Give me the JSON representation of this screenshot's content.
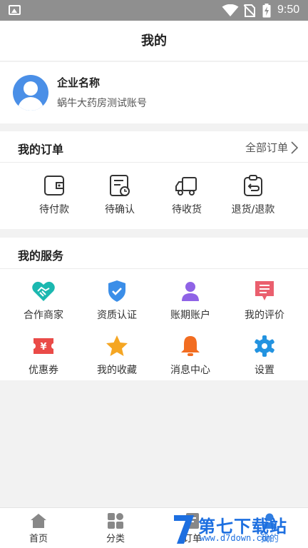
{
  "status_bar": {
    "time": "9:50"
  },
  "header": {
    "title": "我的"
  },
  "profile": {
    "company": "企业名称",
    "account": "蜗牛大药房测试账号"
  },
  "orders": {
    "title": "我的订单",
    "all_label": "全部订单",
    "items": [
      {
        "label": "待付款",
        "icon": "wallet-icon"
      },
      {
        "label": "待确认",
        "icon": "bill-clock-icon"
      },
      {
        "label": "待收货",
        "icon": "truck-icon"
      },
      {
        "label": "退货/退款",
        "icon": "return-icon"
      }
    ]
  },
  "services": {
    "title": "我的服务",
    "items": [
      {
        "label": "合作商家",
        "icon": "handshake-icon",
        "color": "#1bb8b0"
      },
      {
        "label": "资质认证",
        "icon": "shield-check-icon",
        "color": "#3b8ee8"
      },
      {
        "label": "账期账户",
        "icon": "user-icon",
        "color": "#8f63e6"
      },
      {
        "label": "我的评价",
        "icon": "comment-icon",
        "color": "#ea5f6e"
      },
      {
        "label": "优惠券",
        "icon": "coupon-icon",
        "color": "#ea4b48"
      },
      {
        "label": "我的收藏",
        "icon": "star-icon",
        "color": "#f5a623"
      },
      {
        "label": "消息中心",
        "icon": "bell-icon",
        "color": "#f26d21"
      },
      {
        "label": "设置",
        "icon": "gear-icon",
        "color": "#2393e0"
      }
    ]
  },
  "bottom_nav": {
    "tabs": [
      {
        "label": "首页",
        "icon": "home-icon"
      },
      {
        "label": "分类",
        "icon": "category-icon"
      },
      {
        "label": "订单",
        "icon": "order-icon"
      },
      {
        "label": "我的",
        "icon": "profile-icon"
      }
    ],
    "active_index": 3
  },
  "watermark": {
    "text": "第七下载站",
    "url": "www.d7down.com"
  }
}
